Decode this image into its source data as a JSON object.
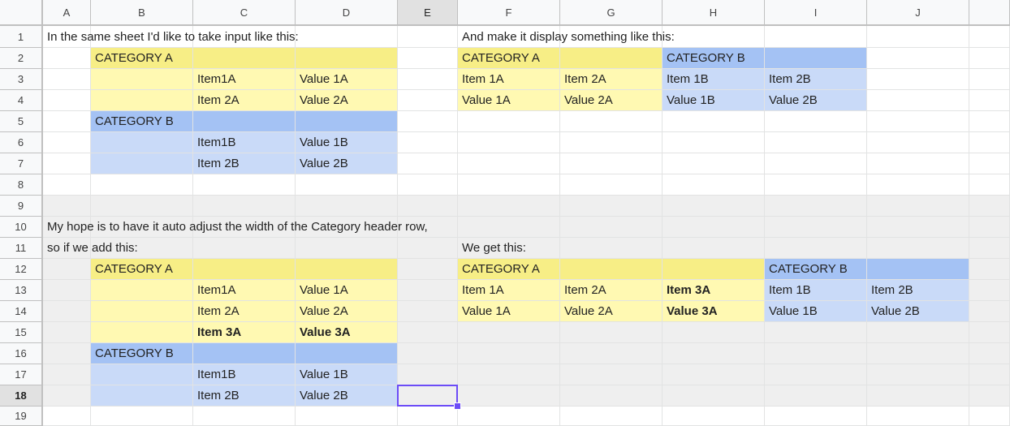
{
  "columns": [
    "A",
    "B",
    "C",
    "D",
    "E",
    "F",
    "G",
    "H",
    "I",
    "J"
  ],
  "rows": [
    1,
    2,
    3,
    4,
    5,
    6,
    7,
    8,
    9,
    10,
    11,
    12,
    13,
    14,
    15,
    16,
    17,
    18,
    19
  ],
  "selected": {
    "col": "E",
    "row": 18
  },
  "colors": {
    "light_yellow": "#fff9b2",
    "dark_yellow": "#f7ee86",
    "light_blue": "#c9daf8",
    "dark_blue": "#a4c2f4",
    "gray_fill": "#efefef",
    "selection": "#6c4cf7"
  },
  "cells": {
    "A1": "In the same sheet I'd like to take input like this:",
    "F1": "And make it display something like this:",
    "B2": "CATEGORY A",
    "F2": "CATEGORY A",
    "H2": "CATEGORY B",
    "C3": "Item1A",
    "D3": "Value 1A",
    "F3": "Item 1A",
    "G3": "Item 2A",
    "H3": "Item 1B",
    "I3": "Item 2B",
    "C4": "Item 2A",
    "D4": "Value 2A",
    "F4": "Value 1A",
    "G4": "Value 2A",
    "H4": "Value 1B",
    "I4": "Value 2B",
    "B5": "CATEGORY B",
    "C6": "Item1B",
    "D6": "Value 1B",
    "C7": "Item 2B",
    "D7": "Value 2B",
    "A10": "My hope is to have it auto adjust the width of the Category header row,",
    "A11": "so if we add this:",
    "F11": "We get this:",
    "B12": "CATEGORY A",
    "F12": "CATEGORY A",
    "I12": "CATEGORY B",
    "C13": "Item1A",
    "D13": "Value 1A",
    "F13": "Item 1A",
    "G13": "Item 2A",
    "H13": "Item 3A",
    "I13": "Item 1B",
    "J13": "Item 2B",
    "C14": "Item 2A",
    "D14": "Value 2A",
    "F14": "Value 1A",
    "G14": "Value 2A",
    "H14": "Value 3A",
    "I14": "Value 1B",
    "J14": "Value 2B",
    "C15": "Item 3A",
    "D15": "Value 3A",
    "B16": "CATEGORY B",
    "C17": "Item1B",
    "D17": "Value 1B",
    "C18": "Item 2B",
    "D18": "Value 2B"
  }
}
